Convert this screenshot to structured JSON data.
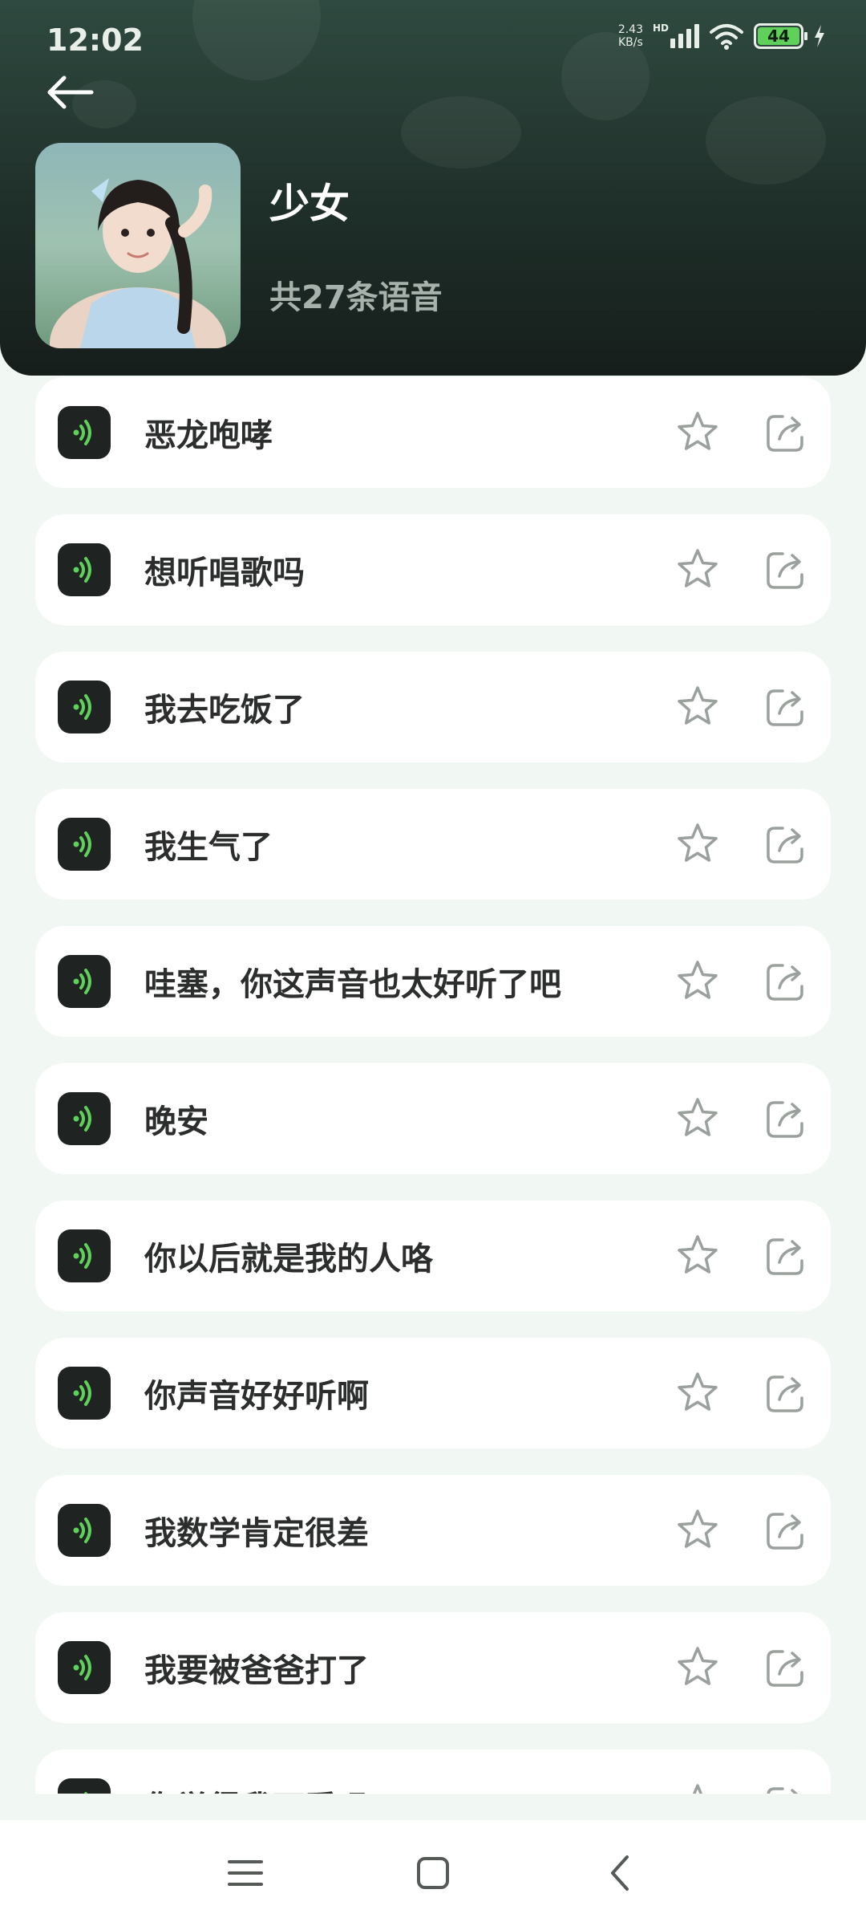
{
  "status_bar": {
    "time": "12:02",
    "net_speed_value": "2.43",
    "net_speed_unit": "KB/s",
    "network_badge": "HD",
    "battery_level": "44"
  },
  "header": {
    "title": "少女",
    "subtitle": "共27条语音"
  },
  "voice_items": [
    {
      "label": "恶龙咆哮"
    },
    {
      "label": "想听唱歌吗"
    },
    {
      "label": "我去吃饭了"
    },
    {
      "label": "我生气了"
    },
    {
      "label": "哇塞，你这声音也太好听了吧"
    },
    {
      "label": "晚安"
    },
    {
      "label": "你以后就是我的人咯"
    },
    {
      "label": "你声音好好听啊"
    },
    {
      "label": "我数学肯定很差"
    },
    {
      "label": "我要被爸爸打了"
    },
    {
      "label": "你觉得我可爱吗"
    }
  ],
  "colors": {
    "header_bg": "#1f2f29",
    "page_bg": "#f1f7f2",
    "accent_green": "#5fd15a",
    "play_button_bg": "#1f2321",
    "icon_gray": "#9aa09c"
  },
  "icons": {
    "back": "arrow-left-icon",
    "play": "sound-wave-icon",
    "favorite": "star-outline-icon",
    "share": "share-icon",
    "nav_menu": "menu-icon",
    "nav_home": "home-square-icon",
    "nav_back": "chevron-left-icon"
  }
}
